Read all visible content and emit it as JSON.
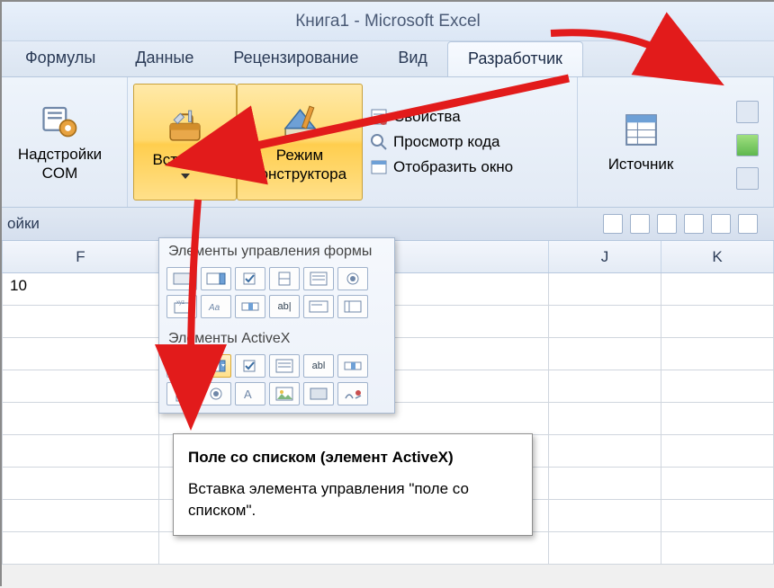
{
  "title": "Книга1  -  Microsoft Excel",
  "tabs": {
    "formulas": "Формулы",
    "data": "Данные",
    "review": "Рецензирование",
    "view": "Вид",
    "developer": "Разработчик"
  },
  "ribbon": {
    "com_addins": "Надстройки\nCOM",
    "insert": "Вставить",
    "design_mode": "Режим\nконструктора",
    "properties": "Свойства",
    "view_code": "Просмотр кода",
    "run_dialog": "Отобразить окно",
    "source": "Источник"
  },
  "lower_label": "ойки",
  "dropdown": {
    "form_controls": "Элементы управления формы",
    "activex_controls": "Элементы ActiveX"
  },
  "tooltip": {
    "title": "Поле со списком (элемент ActiveX)",
    "body": "Вставка элемента управления \"поле со списком\"."
  },
  "columns": {
    "F": "F",
    "J": "J",
    "K": "K"
  },
  "cell_value": "10",
  "icons": {
    "addins": "addins-icon",
    "insert": "toolbox-icon",
    "design": "ruler-pencil-icon",
    "properties": "property-sheet-icon",
    "code": "magnifier-code-icon",
    "dialog": "window-icon",
    "source": "xml-panel-icon"
  }
}
